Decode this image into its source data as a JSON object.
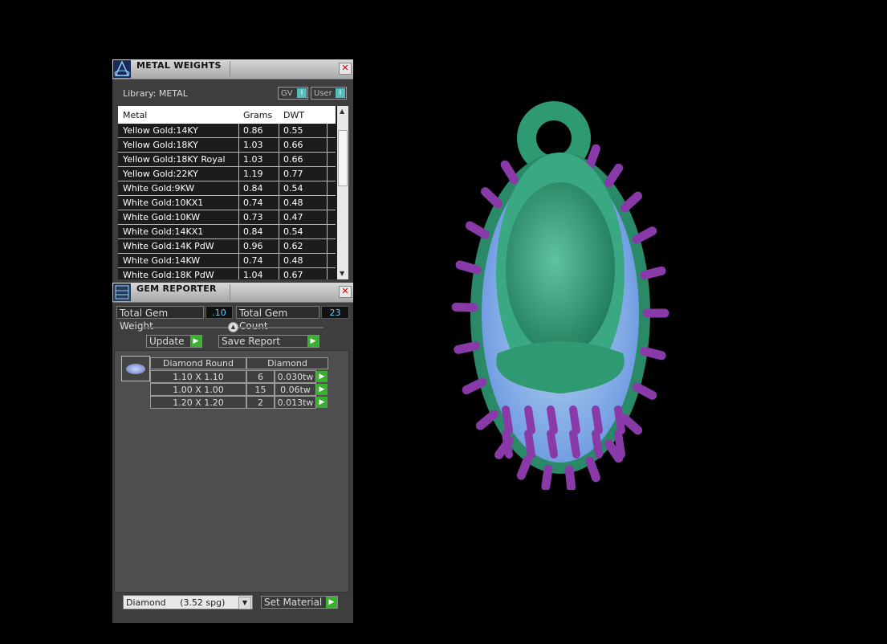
{
  "metal_panel": {
    "title": "METAL WEIGHTS",
    "library": "Library: METAL",
    "gv_label": "GV",
    "user_label": "User",
    "columns": [
      "Metal",
      "Grams",
      "DWT"
    ],
    "rows": [
      {
        "metal": "Yellow Gold:14KY",
        "grams": "0.86",
        "dwt": "0.55"
      },
      {
        "metal": "Yellow Gold:18KY",
        "grams": "1.03",
        "dwt": "0.66"
      },
      {
        "metal": "Yellow Gold:18KY Royal",
        "grams": "1.03",
        "dwt": "0.66"
      },
      {
        "metal": "Yellow Gold:22KY",
        "grams": "1.19",
        "dwt": "0.77"
      },
      {
        "metal": "White Gold:9KW",
        "grams": "0.84",
        "dwt": "0.54"
      },
      {
        "metal": "White Gold:10KX1",
        "grams": "0.74",
        "dwt": "0.48"
      },
      {
        "metal": "White Gold:10KW",
        "grams": "0.73",
        "dwt": "0.47"
      },
      {
        "metal": "White Gold:14KX1",
        "grams": "0.84",
        "dwt": "0.54"
      },
      {
        "metal": "White Gold:14K PdW",
        "grams": "0.96",
        "dwt": "0.62"
      },
      {
        "metal": "White Gold:14KW",
        "grams": "0.74",
        "dwt": "0.48"
      },
      {
        "metal": "White Gold:18K PdW",
        "grams": "1.04",
        "dwt": "0.67"
      }
    ]
  },
  "gem_panel": {
    "title": "GEM REPORTER",
    "total_weight_label": "Total Gem Weight",
    "total_weight_value": ".10",
    "total_count_label": "Total Gem Count",
    "total_count_value": "23",
    "update_label": "Update",
    "save_label": "Save Report",
    "table": {
      "shape_header": "Diamond Round",
      "material_header": "Diamond",
      "rows": [
        {
          "size": "1.10 X 1.10",
          "count": "6",
          "weight": "0.030tw"
        },
        {
          "size": "1.00 X 1.00",
          "count": "15",
          "weight": "0.06tw"
        },
        {
          "size": "1.20 X 1.20",
          "count": "2",
          "weight": "0.013tw"
        }
      ]
    },
    "material_select": "Diamond     (3.52 spg)",
    "set_material_label": "Set Material"
  },
  "colors": {
    "metal_green": "#2f9a72",
    "prong_purple": "#8a3aa8",
    "gem_blue": "#8eb4ff"
  }
}
